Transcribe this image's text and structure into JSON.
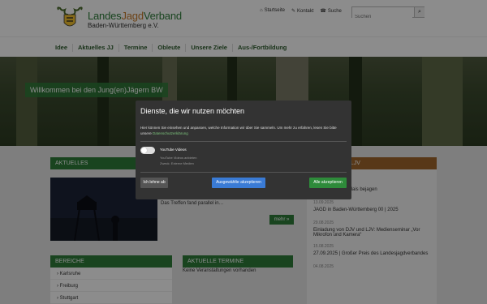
{
  "header": {
    "logo_text_a": "Landes",
    "logo_text_b": "Jagd",
    "logo_text_c": "Verband",
    "logo_sub": "Baden-Württemberg e.V.",
    "toplinks": [
      {
        "icon": "home-icon",
        "label": "Startseite"
      },
      {
        "icon": "pencil-icon",
        "label": "Kontakt"
      },
      {
        "icon": "phone-icon",
        "label": "Suche"
      }
    ],
    "search_placeholder": "Suchen"
  },
  "nav": {
    "items": [
      "Idee",
      "Aktuelles JJ",
      "Termine",
      "Obleute",
      "Unsere Ziele",
      "Aus-/Fortbildung"
    ]
  },
  "hero": {
    "title": "Willkommen bei den Jung(en)Jägern BW"
  },
  "aktuelles": {
    "heading": "AKTUELLES",
    "snippet": "Das Treffen fand parallel in…",
    "more_label": "mehr"
  },
  "themen": {
    "heading": "THEMEN DES LJV",
    "items": [
      {
        "title": "Schwarzwild im Mais bejagen",
        "date": ""
      },
      {
        "title": "JAGD in Baden-Württemberg 00 | 2025",
        "date": "13.09.2025"
      },
      {
        "title": "Einladung von DJV und LJV: Medienseminar „Vor Mikrofon und Kamera“",
        "date": "29.08.2025"
      },
      {
        "title": "27.09.2025 | Großer Preis des Landesjagdverbandes",
        "date": "15.08.2025"
      },
      {
        "title": "",
        "date": "04.08.2025"
      }
    ]
  },
  "bereiche": {
    "heading": "BEREICHE",
    "items": [
      "Karlsruhe",
      "Freiburg",
      "Stuttgart"
    ]
  },
  "termine": {
    "heading": "AKTUELLE TERMINE",
    "empty_text": "Keine Veranstaltungen vorhanden"
  },
  "cookie_modal": {
    "title": "Dienste, die wir nutzen möchten",
    "description": "Hier können Sie einsehen und anpassen, welche Information wir über Sie sammeln. Um mehr zu erfahren, lesen Sie bitte unsere",
    "link_text": "Datenschutzerklärung",
    "service_name": "YouTube Videos",
    "service_sub1": "YouTube Videos anbieten",
    "service_sub2": "Zweck: Externe Medien",
    "decline_label": "Ich lehne ab",
    "accept_selected_label": "Ausgewählte akzeptieren",
    "accept_all_label": "Alle akzeptieren"
  },
  "colors": {
    "brand_green": "#2e7d3a",
    "brand_brown": "#a0672c",
    "accept_blue": "#3a7bd5"
  }
}
